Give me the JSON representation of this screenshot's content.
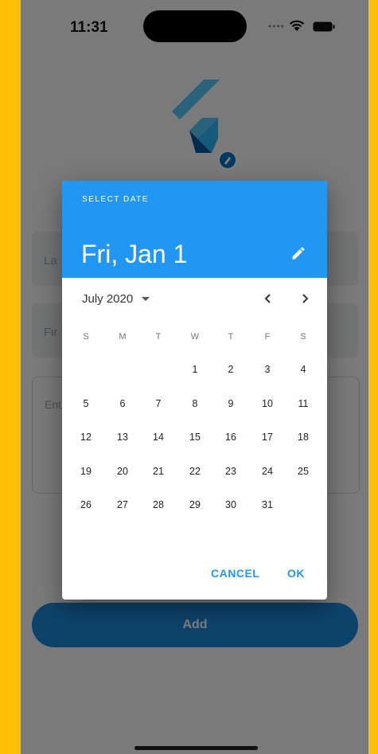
{
  "status": {
    "time": "11:31"
  },
  "form": {
    "last_name_placeholder": "La",
    "first_name_placeholder": "Fir",
    "entry_placeholder": "Ent",
    "add_label": "Add"
  },
  "dialog": {
    "header_label": "SELECT DATE",
    "selected_date": "Fri, Jan 1",
    "month_label": "July 2020",
    "weekdays": [
      "S",
      "M",
      "T",
      "W",
      "T",
      "F",
      "S"
    ],
    "first_weekday_index": 3,
    "days_in_month": 31,
    "cancel_label": "CANCEL",
    "ok_label": "OK"
  },
  "colors": {
    "accent": "#2196F3",
    "frame": "#FFC107",
    "add_button": "#1a86d6"
  },
  "icons": [
    "wifi-icon",
    "battery-icon",
    "flutter-logo-icon",
    "pencil-icon",
    "caret-down-icon",
    "chevron-left-icon",
    "chevron-right-icon"
  ]
}
